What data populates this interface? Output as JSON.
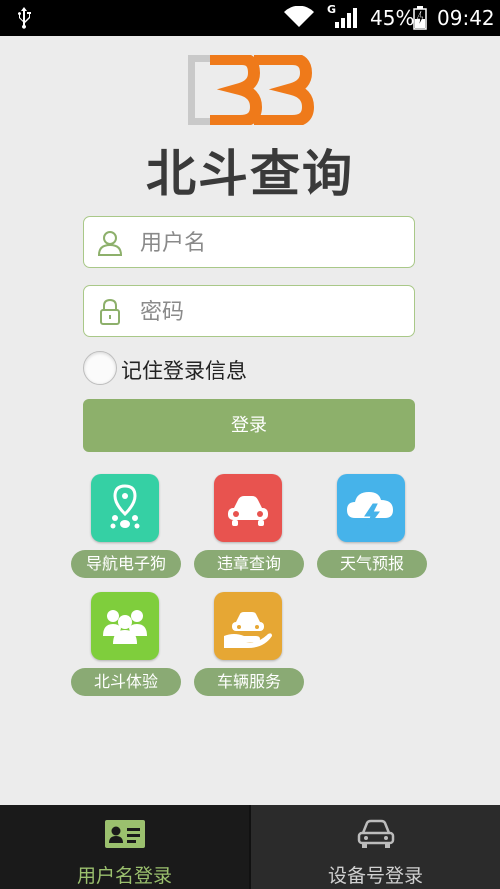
{
  "status_bar": {
    "network_type": "G",
    "battery_percent": "45%",
    "time": "09:42",
    "icons": [
      "usb-icon",
      "wifi-icon",
      "signal-icon",
      "battery-charging-icon"
    ]
  },
  "app": {
    "logo_icon": "bdsjb-logo-icon",
    "title": "北斗查询"
  },
  "login_form": {
    "username_placeholder": "用户名",
    "username_value": "",
    "password_placeholder": "密码",
    "password_value": "",
    "remember_label": "记住登录信息",
    "remember_checked": false,
    "login_label": "登录",
    "accent_color": "#8db06b"
  },
  "services": [
    {
      "label": "导航电子狗",
      "icon": "location-pin-icon",
      "color": "#35d0a4"
    },
    {
      "label": "违章查询",
      "icon": "car-icon",
      "color": "#e8534f"
    },
    {
      "label": "天气预报",
      "icon": "cloud-lightning-icon",
      "color": "#46b3ea"
    },
    {
      "label": "北斗体验",
      "icon": "people-icon",
      "color": "#7fce3c"
    },
    {
      "label": "车辆服务",
      "icon": "car-in-hand-icon",
      "color": "#e6a734"
    }
  ],
  "bottom_nav": {
    "tabs": [
      {
        "label": "用户名登录",
        "icon": "id-card-icon",
        "active": true,
        "color": "#9bc06e"
      },
      {
        "label": "设备号登录",
        "icon": "car-front-icon",
        "active": false,
        "color": "#bcbcbc"
      }
    ]
  }
}
